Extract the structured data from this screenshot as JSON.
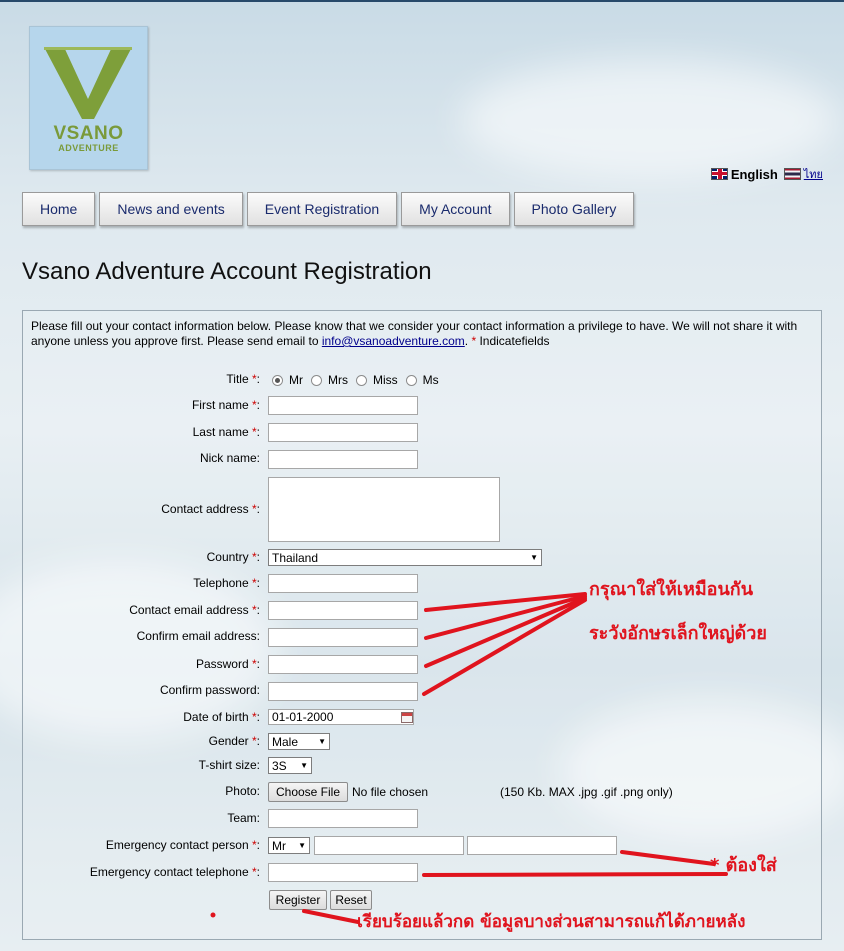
{
  "logo": {
    "line1": "VSANO",
    "line2": "ADVENTURE"
  },
  "language": {
    "english": "English",
    "thai": "ไทย"
  },
  "nav": [
    "Home",
    "News and events",
    "Event Registration",
    "My Account",
    "Photo Gallery"
  ],
  "page_title": "Vsano Adventure Account Registration",
  "intro": {
    "text1": "Please fill out your contact information below. Please know that we consider your contact information a privilege to have. We will not share it with anyone unless you approve first. Please send email to ",
    "email": "info@vsanoadventure.com",
    "text2": ". ",
    "star": "*",
    "text3": " Indicatefields"
  },
  "form": {
    "title_label": "Title",
    "title_options": [
      "Mr",
      "Mrs",
      "Miss",
      "Ms"
    ],
    "title_selected": "Mr",
    "first_name_label": "First name",
    "last_name_label": "Last name",
    "nick_name_label": "Nick name:",
    "contact_address_label": "Contact address",
    "country_label": "Country",
    "country_value": "Thailand",
    "telephone_label": "Telephone",
    "contact_email_label": "Contact email address",
    "confirm_email_label": "Confirm email address:",
    "password_label": "Password",
    "confirm_password_label": "Confirm password:",
    "dob_label": "Date of birth",
    "dob_value": "01-01-2000",
    "gender_label": "Gender",
    "gender_value": "Male",
    "tshirt_label": "T-shirt size:",
    "tshirt_value": "3S",
    "photo_label": "Photo:",
    "choose_file": "Choose File",
    "no_file": "No file chosen",
    "photo_hint": "(150 Kb. MAX .jpg .gif .png only)",
    "team_label": "Team:",
    "emergency_person_label": "Emergency contact person",
    "emergency_title_value": "Mr",
    "emergency_phone_label": "Emergency contact telephone",
    "req_suffix": " *:",
    "register": "Register",
    "reset": "Reset"
  },
  "annotations": {
    "same_value": "กรุณาใส่ให้เหมือนกัน",
    "case_sensitive": "ระวังอักษรเล็กใหญ่ด้วย",
    "required": "* ต้องใส่",
    "done": "เรียบร้อยแล้วกด  ข้อมูลบางส่วนสามารถแก้ได้ภายหลัง"
  },
  "colors": {
    "annotation": "#e0141e",
    "nav_text": "#1a2b6d",
    "required": "#cc0000"
  }
}
